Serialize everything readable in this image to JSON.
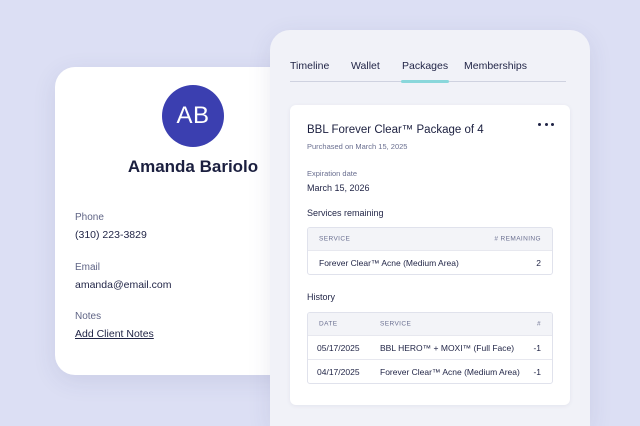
{
  "client": {
    "initials": "AB",
    "name": "Amanda Bariolo",
    "phone_label": "Phone",
    "phone": "(310) 223-3829",
    "email_label": "Email",
    "email": "amanda@email.com",
    "notes_label": "Notes",
    "notes_link": "Add Client Notes"
  },
  "tabs": [
    {
      "label": "Timeline"
    },
    {
      "label": "Wallet"
    },
    {
      "label": "Packages",
      "active": true
    },
    {
      "label": "Memberships"
    }
  ],
  "package": {
    "title": "BBL Forever Clear™ Package of 4",
    "purchased": "Purchased on March 15, 2025",
    "expiration_label": "Expiration date",
    "expiration": "March 15, 2026",
    "services_heading": "Services remaining",
    "services_columns": [
      "SERVICE",
      "# REMAINING"
    ],
    "services": [
      {
        "service": "Forever Clear™ Acne (Medium Area)",
        "remaining": "2"
      }
    ],
    "history_heading": "History",
    "history_columns": [
      "DATE",
      "SERVICE",
      "#"
    ],
    "history": [
      {
        "date": "05/17/2025",
        "service": "BBL HERO™ + MOXI™ (Full Face)",
        "count": "-1"
      },
      {
        "date": "04/17/2025",
        "service": "Forever Clear™ Acne (Medium Area)",
        "count": "-1"
      }
    ]
  },
  "colors": {
    "background": "#dcdff4",
    "avatar": "#3b3fb0",
    "tab_indicator": "#8ad7db"
  }
}
